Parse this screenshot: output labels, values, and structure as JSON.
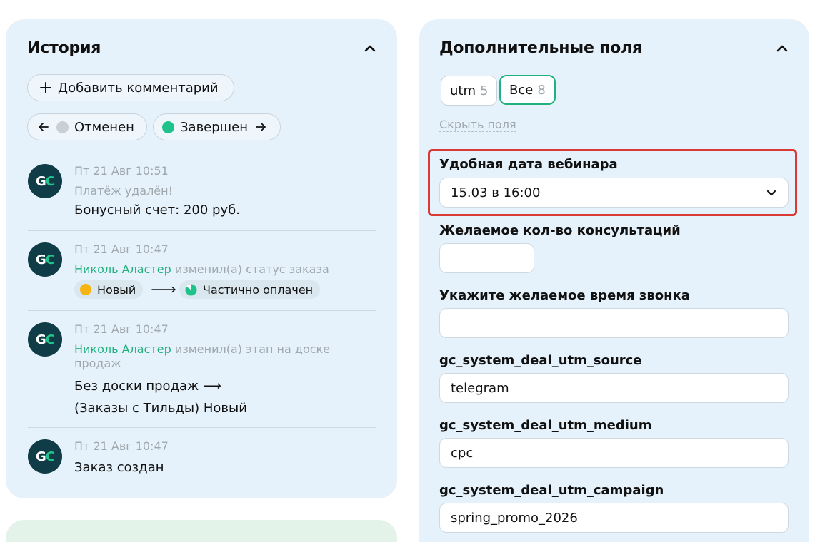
{
  "history": {
    "title": "История",
    "add_comment": "Добавить комментарий",
    "prev_status": "Отменен",
    "next_status": "Завершен",
    "colors": {
      "canceled_dot": "#c9d0d5",
      "done_dot": "#1fc28a",
      "new_dot": "#f6b40e",
      "partial_dot": "#1fc28a"
    },
    "entries": [
      {
        "time": "Пт 21 Авг 10:51",
        "note": "Платёж удалён!",
        "text": "Бонусный счет: 200 руб."
      },
      {
        "time": "Пт 21 Авг 10:47",
        "user": "Николь Аластер",
        "action": "изменил(а) статус заказа",
        "from_status": "Новый",
        "to_status": "Частично оплачен"
      },
      {
        "time": "Пт 21 Авг 10:47",
        "user": "Николь Аластер",
        "action": "изменил(а) этап на доске",
        "action_line2": "продаж",
        "line1": "Без доски продаж ⟶",
        "line2": "(Заказы с Тильды) Новый"
      },
      {
        "time": "Пт 21 Авг 10:47",
        "text": "Заказ создан"
      }
    ],
    "avatar": {
      "letter1": "G",
      "letter2": "C"
    }
  },
  "extra": {
    "title": "Дополнительные поля",
    "tabs": [
      {
        "label": "utm",
        "count": "5"
      },
      {
        "label": "Все",
        "count": "8"
      }
    ],
    "hide_fields": "Скрыть поля",
    "fields": [
      {
        "label": "Удобная дата вебинара",
        "value": "15.03 в 16:00"
      },
      {
        "label": "Желаемое кол-во консультаций",
        "value": ""
      },
      {
        "label": "Укажите желаемое время звонка",
        "value": ""
      },
      {
        "label": "gc_system_deal_utm_source",
        "value": "telegram"
      },
      {
        "label": "gc_system_deal_utm_medium",
        "value": "cpc"
      },
      {
        "label": "gc_system_deal_utm_campaign",
        "value": "spring_promo_2026"
      }
    ]
  },
  "icons": {
    "collapse": "chevron-up-icon",
    "plus": "plus-icon",
    "arrow_left": "arrow-left-icon",
    "arrow_right": "arrow-right-icon",
    "dropdown": "chevron-down-icon"
  }
}
